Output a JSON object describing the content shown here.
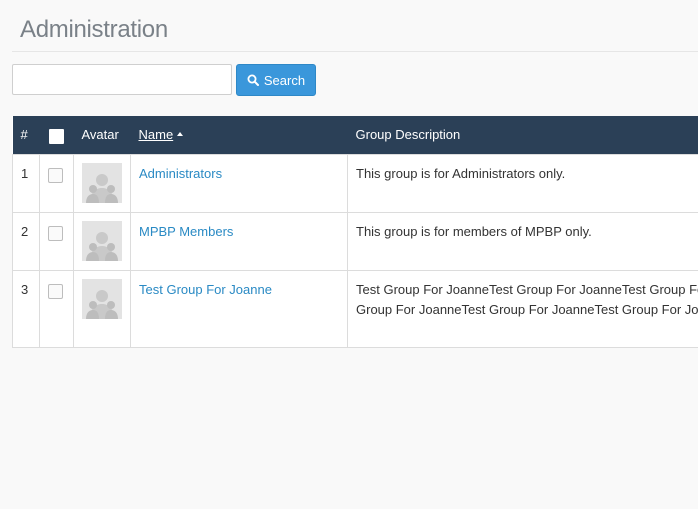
{
  "header": {
    "title": "Administration"
  },
  "search": {
    "placeholder": "",
    "value": "",
    "button_label": "Search",
    "button_icon": "search-icon"
  },
  "table": {
    "columns": {
      "num": "#",
      "avatar": "Avatar",
      "name": "Name",
      "description": "Group Description"
    },
    "sort": {
      "column": "Name",
      "direction": "ascending"
    },
    "rows": [
      {
        "num": "1",
        "name": "Administrators",
        "description": "This group is for Administrators only."
      },
      {
        "num": "2",
        "name": "MPBP Members",
        "description": "This group is for members of MPBP only."
      },
      {
        "num": "3",
        "name": "Test Group For Joanne",
        "description_line1": "Test Group For JoanneTest Group For JoanneTest Group For",
        "description_line2": "Group For JoanneTest Group For JoanneTest Group For Jo"
      }
    ]
  },
  "colors": {
    "header_bg": "#2b4057",
    "accent": "#3a97db",
    "link": "#2a8ac4"
  }
}
